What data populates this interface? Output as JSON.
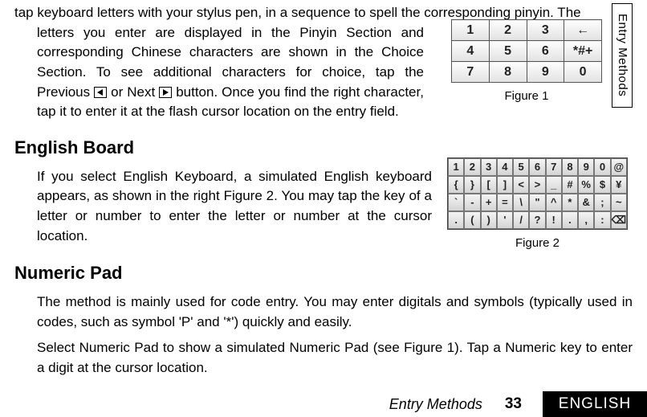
{
  "sideTab": "Entry Methods",
  "topPara": {
    "line1": "tap keyboard letters with your stylus pen, in a sequence to spell the corresponding pinyin. The",
    "rest_a": "letters you enter are displayed in the Pinyin Section and corresponding Chinese characters are shown in the Choice Section. To see additional characters for choice, tap the Previous ",
    "rest_b": " or Next ",
    "rest_c": " button. Once you find the right character, tap it to enter it at the flash cursor location on the entry field."
  },
  "fig1": {
    "caption": "Figure 1",
    "keys": [
      [
        "1",
        "2",
        "3",
        "←"
      ],
      [
        "4",
        "5",
        "6",
        "*#+"
      ],
      [
        "7",
        "8",
        "9",
        "0"
      ]
    ]
  },
  "headings": {
    "englishBoard": "English Board",
    "numericPad": "Numeric Pad"
  },
  "englishPara": "If you select English Keyboard, a simulated English keyboard appears, as shown in the right Figure 2. You may tap the key of a letter or number to enter the letter or number at the cursor location.",
  "fig2": {
    "caption": "Figure 2",
    "keys": [
      [
        "1",
        "2",
        "3",
        "4",
        "5",
        "6",
        "7",
        "8",
        "9",
        "0",
        "@"
      ],
      [
        "{",
        "}",
        "[",
        "]",
        "<",
        ">",
        "_",
        "#",
        "%",
        "$",
        "¥"
      ],
      [
        "`",
        "-",
        "+",
        "=",
        "\\",
        "\"",
        "^",
        "*",
        "&",
        ";",
        "~"
      ],
      [
        ".",
        "(",
        ")",
        "'",
        "/",
        "?",
        "!",
        ".",
        ",",
        ":",
        "⌫"
      ]
    ]
  },
  "numericPara1": "The method is mainly used for code entry. You may enter digitals and symbols (typically used in codes, such as symbol 'P' and '*') quickly and easily.",
  "numericPara2": "Select Numeric Pad to show a simulated Numeric Pad (see Figure 1). Tap a Numeric key to enter a digit at the cursor location.",
  "footer": {
    "title": "Entry Methods",
    "page": "33",
    "lang": "ENGLISH"
  }
}
